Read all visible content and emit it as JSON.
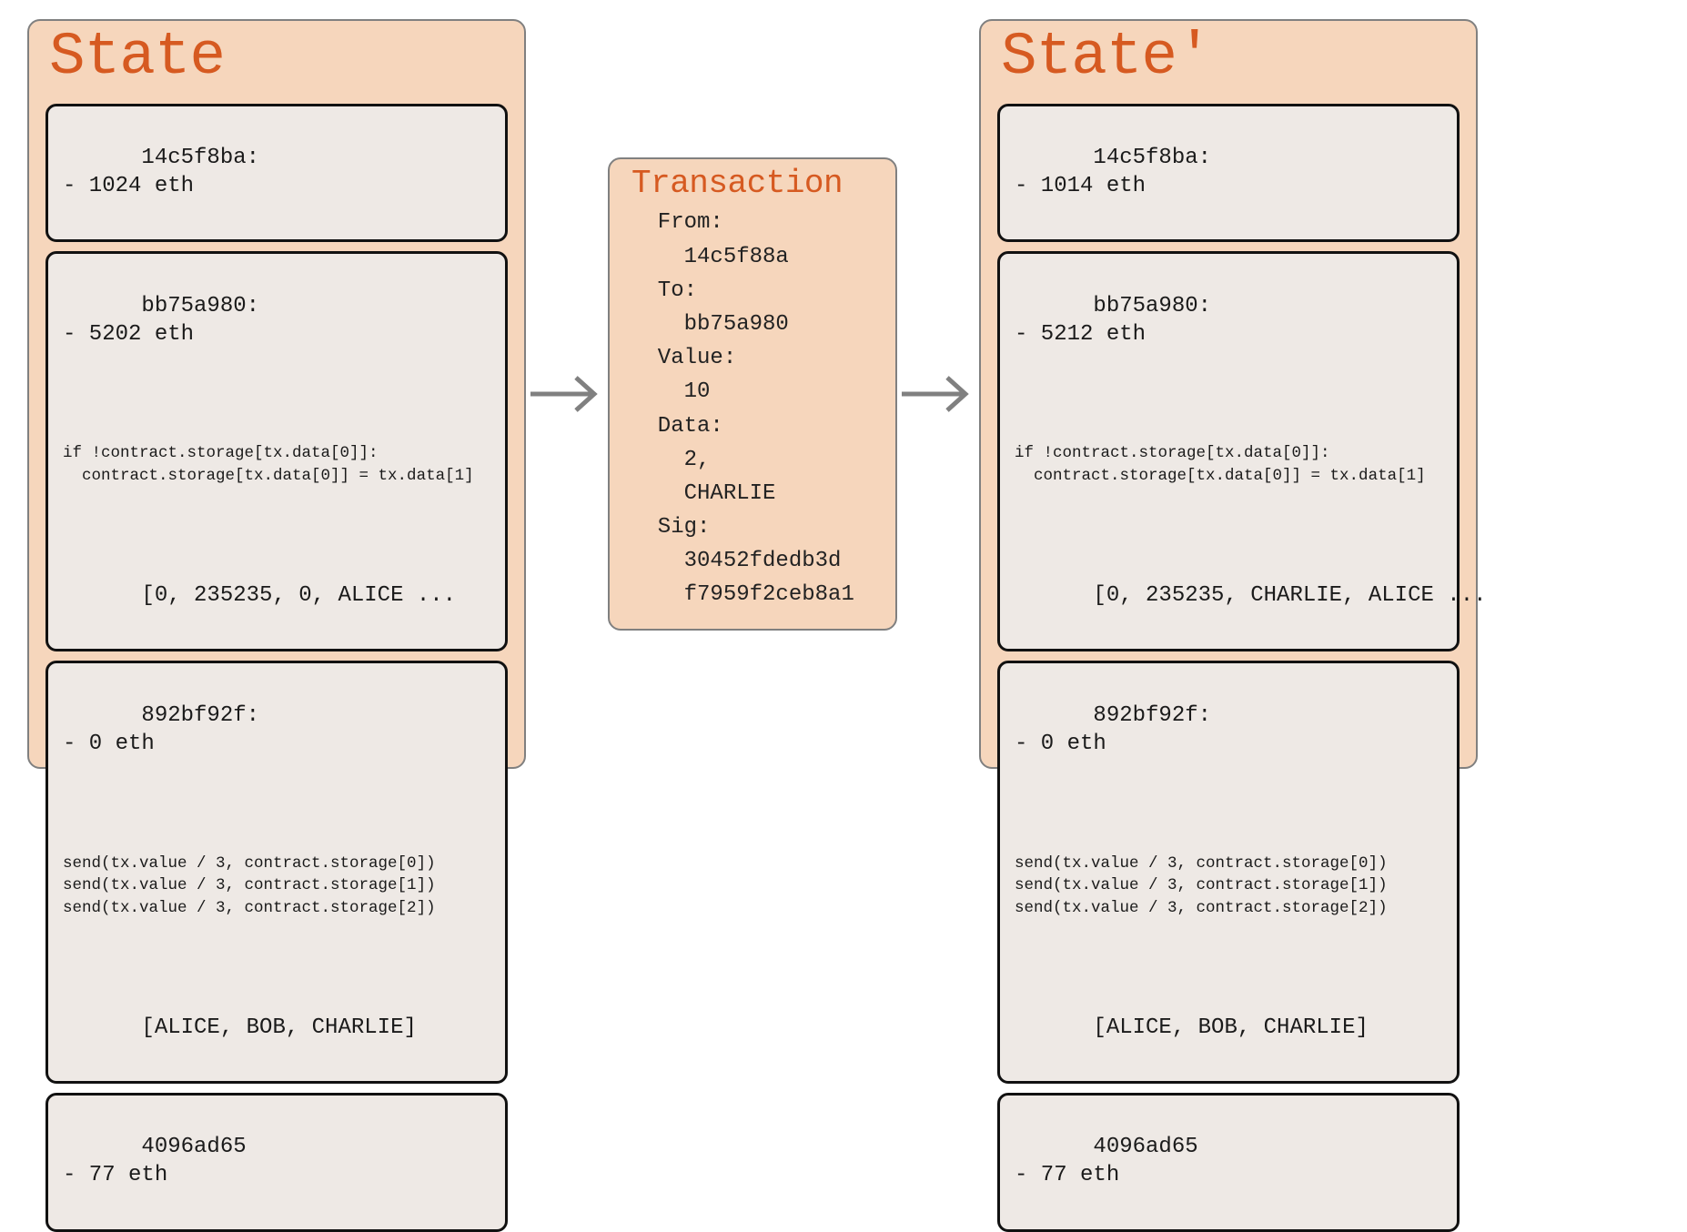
{
  "state_left": {
    "title": "State",
    "accounts": [
      {
        "header": "14c5f8ba:\n- 1024 eth"
      },
      {
        "header": "bb75a980:\n- 5202 eth",
        "code": "if !contract.storage[tx.data[0]]:\n  contract.storage[tx.data[0]] = tx.data[1]",
        "storage": "[0, 235235, 0, ALICE ..."
      },
      {
        "header": "892bf92f:\n- 0 eth",
        "code": "send(tx.value / 3, contract.storage[0])\nsend(tx.value / 3, contract.storage[1])\nsend(tx.value / 3, contract.storage[2])",
        "storage": "[ALICE, BOB, CHARLIE]"
      },
      {
        "header": "4096ad65\n- 77 eth"
      }
    ]
  },
  "transaction": {
    "title": "Transaction",
    "body": "  From:\n    14c5f88a\n  To:\n    bb75a980\n  Value:\n    10\n  Data:\n    2,\n    CHARLIE\n  Sig:\n    30452fdedb3d\n    f7959f2ceb8a1"
  },
  "state_right": {
    "title": "State'",
    "accounts": [
      {
        "header": "14c5f8ba:\n- 1014 eth"
      },
      {
        "header": "bb75a980:\n- 5212 eth",
        "code": "if !contract.storage[tx.data[0]]:\n  contract.storage[tx.data[0]] = tx.data[1]",
        "storage": "[0, 235235, CHARLIE, ALICE ..."
      },
      {
        "header": "892bf92f:\n- 0 eth",
        "code": "send(tx.value / 3, contract.storage[0])\nsend(tx.value / 3, contract.storage[1])\nsend(tx.value / 3, contract.storage[2])",
        "storage": "[ALICE, BOB, CHARLIE]"
      },
      {
        "header": "4096ad65\n- 77 eth"
      }
    ]
  }
}
